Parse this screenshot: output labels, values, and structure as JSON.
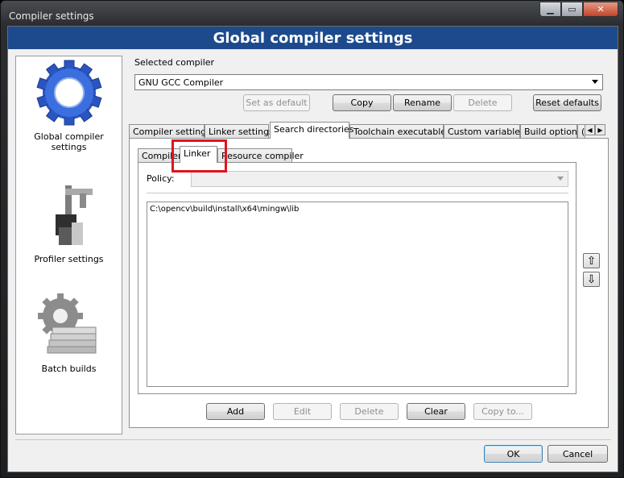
{
  "window": {
    "title": "Compiler settings"
  },
  "banner": {
    "title": "Global compiler settings"
  },
  "sidebar": {
    "items": [
      {
        "label": "Global compiler settings",
        "icon": "gear-icon"
      },
      {
        "label": "Profiler settings",
        "icon": "caliper-icon"
      },
      {
        "label": "Batch builds",
        "icon": "gear-stack-icon"
      }
    ]
  },
  "compiler": {
    "label": "Selected compiler",
    "selected": "GNU GCC Compiler",
    "buttons": {
      "set_default": "Set as default",
      "copy": "Copy",
      "rename": "Rename",
      "delete": "Delete",
      "reset": "Reset defaults"
    }
  },
  "tabs": [
    "Compiler settings",
    "Linker settings",
    "Search directories",
    "Toolchain executables",
    "Custom variables",
    "Build options",
    "("
  ],
  "subtabs": [
    "Compiler",
    "Linker",
    "Resource compiler"
  ],
  "policy": {
    "label": "Policy:",
    "value": ""
  },
  "directories": [
    "C:\\opencv\\build\\install\\x64\\mingw\\lib"
  ],
  "list_buttons": {
    "add": "Add",
    "edit": "Edit",
    "delete": "Delete",
    "clear": "Clear",
    "copy_to": "Copy to..."
  },
  "dialog_buttons": {
    "ok": "OK",
    "cancel": "Cancel"
  },
  "arrows": {
    "up": "⇧",
    "down": "⇩",
    "tab_left": "◀",
    "tab_right": "▶"
  }
}
